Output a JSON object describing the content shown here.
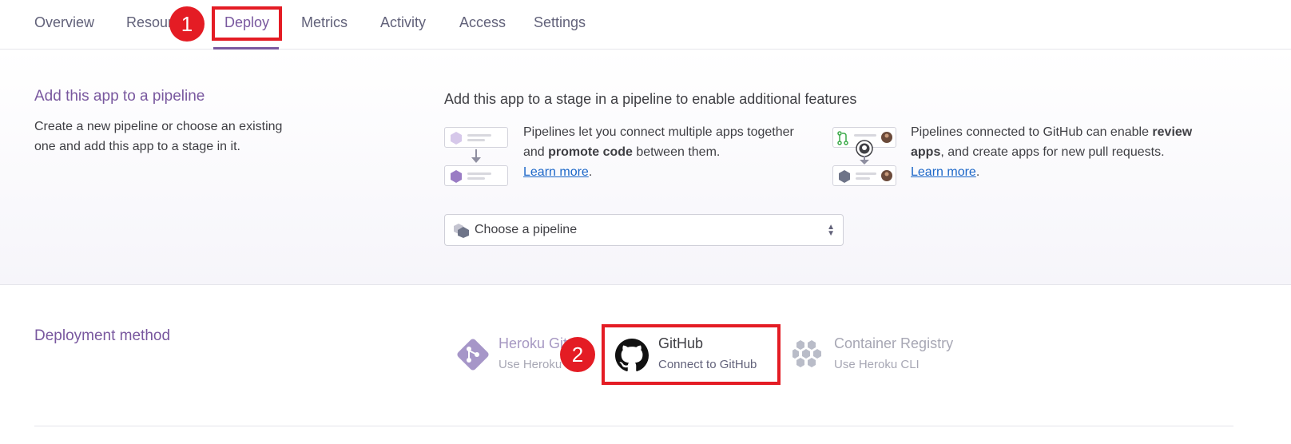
{
  "tabs": [
    {
      "label": "Overview",
      "active": false
    },
    {
      "label": "Resources",
      "active": false
    },
    {
      "label": "Deploy",
      "active": true
    },
    {
      "label": "Metrics",
      "active": false
    },
    {
      "label": "Activity",
      "active": false
    },
    {
      "label": "Access",
      "active": false
    },
    {
      "label": "Settings",
      "active": false
    }
  ],
  "annotations": {
    "step1": "1",
    "step2": "2"
  },
  "pipeline": {
    "title": "Add this app to a pipeline",
    "description": "Create a new pipeline or choose an existing one and add this app to a stage in it.",
    "heading": "Add this app to a stage in a pipeline to enable additional features",
    "feature1": {
      "text_a": "Pipelines let you connect multiple apps together and ",
      "bold": "promote code",
      "text_b": " between them.",
      "link": "Learn more",
      "period": "."
    },
    "feature2": {
      "text_a": "Pipelines connected to GitHub can enable ",
      "bold": "review apps",
      "text_b": ", and create apps for new pull requests.",
      "link": "Learn more",
      "period": "."
    },
    "select_placeholder": "Choose a pipeline"
  },
  "deployment": {
    "title": "Deployment method",
    "methods": [
      {
        "name": "Heroku Git",
        "sub": "Use Heroku CLI",
        "icon": "heroku-git-icon"
      },
      {
        "name": "GitHub",
        "sub": "Connect to GitHub",
        "icon": "github-icon"
      },
      {
        "name": "Container Registry",
        "sub": "Use Heroku CLI",
        "icon": "container-registry-icon"
      }
    ]
  },
  "colors": {
    "accent": "#79589f",
    "highlight": "#e41c24",
    "link": "#1c67c8"
  }
}
